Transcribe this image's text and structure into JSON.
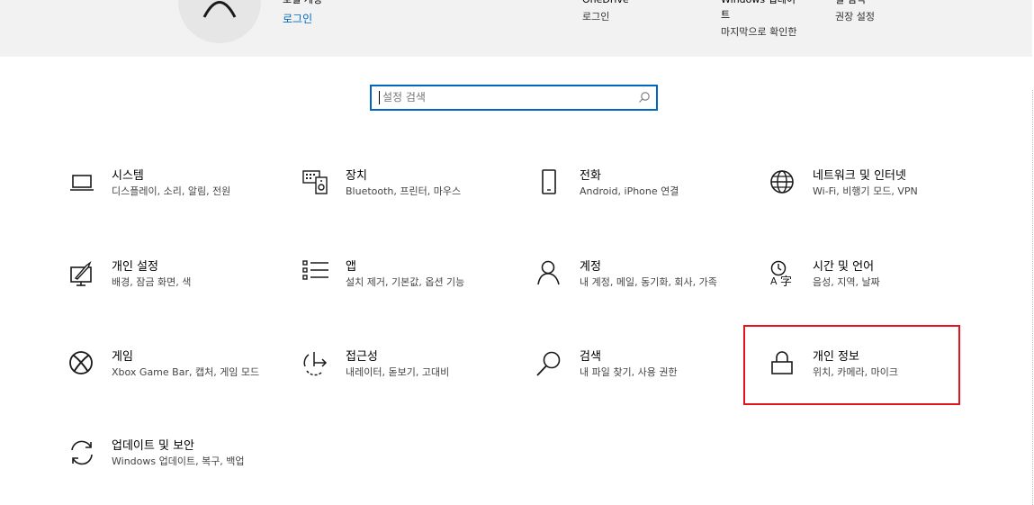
{
  "banner": {
    "account_title": "로컬 계정",
    "account_link": "로그인",
    "onedrive_title": "OneDrive",
    "onedrive_sub": "로그인",
    "update_title_l1": "Windows 업데이",
    "update_title_l2": "트",
    "update_sub": "마지막으로 확인한",
    "rewards_title": "필 점역",
    "rewards_sub": "권장 설정"
  },
  "search": {
    "placeholder": "설정 검색"
  },
  "tiles": [
    {
      "title": "시스템",
      "subtitle": "디스플레이, 소리, 알림, 전원",
      "icon": "laptop-icon"
    },
    {
      "title": "장치",
      "subtitle": "Bluetooth, 프린터, 마우스",
      "icon": "keyboard-speaker-icon"
    },
    {
      "title": "전화",
      "subtitle": "Android, iPhone 연결",
      "icon": "phone-icon"
    },
    {
      "title": "네트워크 및 인터넷",
      "subtitle": "Wi-Fi, 비행기 모드, VPN",
      "icon": "globe-icon"
    },
    {
      "title": "개인 설정",
      "subtitle": "배경, 잠금 화면, 색",
      "icon": "paint-icon"
    },
    {
      "title": "앱",
      "subtitle": "설치 제거, 기본값, 옵션 기능",
      "icon": "apps-list-icon"
    },
    {
      "title": "계정",
      "subtitle": "내 계정, 메일, 동기화, 회사, 가족",
      "icon": "person-icon"
    },
    {
      "title": "시간 및 언어",
      "subtitle": "음성, 지역, 날짜",
      "icon": "time-language-icon"
    },
    {
      "title": "게임",
      "subtitle": "Xbox Game Bar, 캡처, 게임 모드",
      "icon": "xbox-icon"
    },
    {
      "title": "접근성",
      "subtitle": "내레이터, 돋보기, 고대비",
      "icon": "accessibility-icon"
    },
    {
      "title": "검색",
      "subtitle": "내 파일 찾기, 사용 권한",
      "icon": "search-icon"
    },
    {
      "title": "개인 정보",
      "subtitle": "위치, 카메라, 마이크",
      "icon": "lock-icon"
    },
    {
      "title": "업데이트 및 보안",
      "subtitle": "Windows 업데이트, 복구, 백업",
      "icon": "sync-icon"
    }
  ],
  "colors": {
    "accent": "#0067c0",
    "highlight": "#e3141c",
    "banner_bg": "#f2f2f2"
  }
}
